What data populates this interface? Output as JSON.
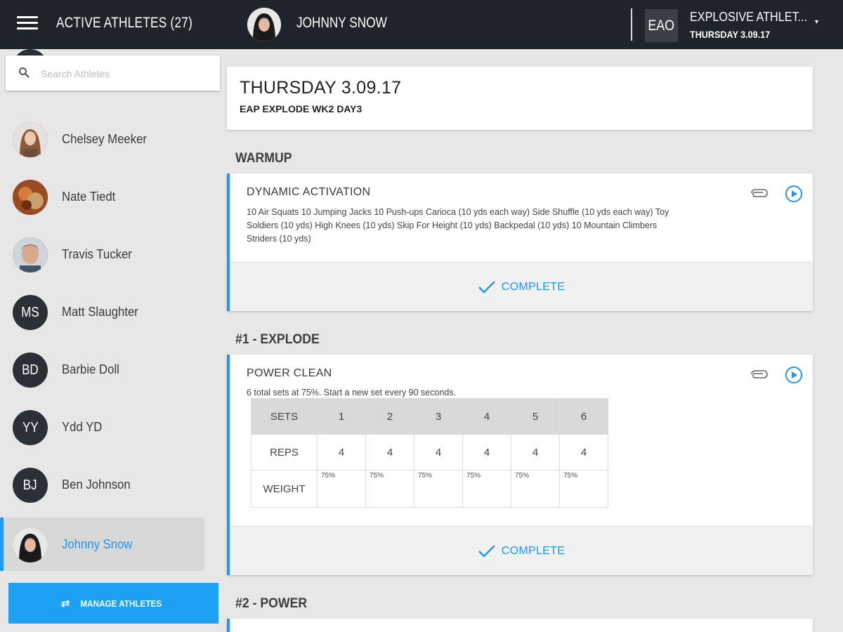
{
  "topbar": {
    "title": "ACTIVE ATHLETES (27)",
    "user_name": "JOHNNY SNOW",
    "org_badge": "EAO",
    "org_name": "EXPLOSIVE ATHLET...",
    "org_date": "THURSDAY 3.09.17"
  },
  "sidebar": {
    "search_placeholder": "Search Athletes",
    "athletes": [
      {
        "name": "Chelsey Meeker",
        "initials": "",
        "photo": true
      },
      {
        "name": "Nate Tiedt",
        "initials": "",
        "photo": true
      },
      {
        "name": "Travis Tucker",
        "initials": "",
        "photo": true
      },
      {
        "name": "Matt Slaughter",
        "initials": "MS",
        "photo": false
      },
      {
        "name": "Barbie Doll",
        "initials": "BD",
        "photo": false
      },
      {
        "name": "Ydd YD",
        "initials": "YY",
        "photo": false
      },
      {
        "name": "Ben Johnson",
        "initials": "BJ",
        "photo": false
      },
      {
        "name": "Johnny Snow",
        "initials": "",
        "photo": true,
        "selected": true
      }
    ],
    "manage_label": "MANAGE ATHLETES"
  },
  "workout": {
    "day_title": "THURSDAY 3.09.17",
    "program": "EAP EXPLODE WK2 DAY3",
    "sections": [
      {
        "title": "WARMUP",
        "exercise": "DYNAMIC ACTIVATION",
        "description": "10 Air Squats 10 Jumping Jacks 10 Push-ups Carioca (10 yds each way) Side Shuffle (10 yds each way) Toy Soldiers (10 yds) High Knees (10 yds) Skip For Height (10 yds) Backpedal (10 yds) 10 Mountain Climbers Striders (10 yds)",
        "complete_label": "COMPLETE"
      },
      {
        "title": "#1 - EXPLODE",
        "exercise": "POWER CLEAN",
        "description": "6 total sets at 75%. Start a new set every 90 seconds.",
        "complete_label": "COMPLETE",
        "table": {
          "row_labels": [
            "SETS",
            "REPS",
            "WEIGHT"
          ],
          "sets": [
            "1",
            "2",
            "3",
            "4",
            "5",
            "6"
          ],
          "reps": [
            "4",
            "4",
            "4",
            "4",
            "4",
            "4"
          ],
          "weights": [
            "75%",
            "75%",
            "75%",
            "75%",
            "75%",
            "75%"
          ]
        }
      },
      {
        "title": "#2 - POWER"
      }
    ]
  },
  "colors": {
    "accent": "#2196f3",
    "topbar": "#1f232a",
    "manage_button": "#1da1f2"
  }
}
